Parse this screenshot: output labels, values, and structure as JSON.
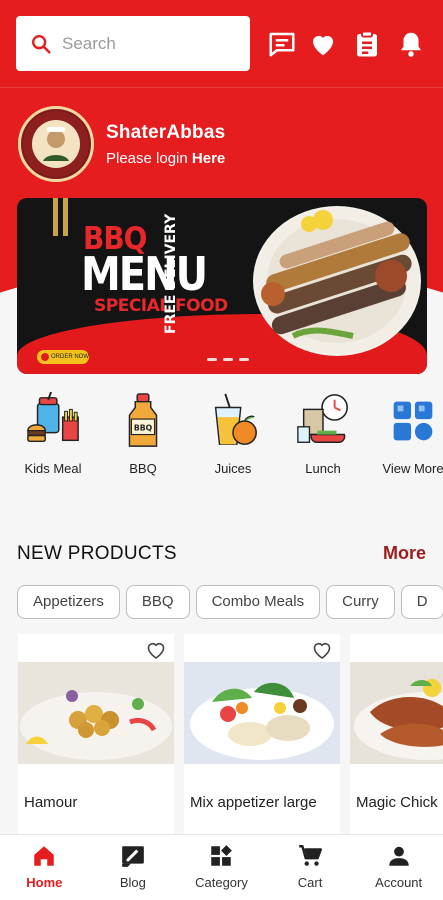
{
  "search": {
    "placeholder": "Search"
  },
  "top_icons": [
    "chat-icon",
    "heart-icon",
    "clipboard-icon",
    "bell-icon"
  ],
  "brand": {
    "name": "ShaterAbbas",
    "login_prefix": "Please login ",
    "login_link": "Here"
  },
  "banner": {
    "line1": "BBQ",
    "line2": "MENU",
    "line3": "SPECIAL FOOD",
    "side": "FREE DELIVERY",
    "order_pill": "ORDER NOW",
    "slide_count": 3
  },
  "categories": [
    {
      "label": "Kids Meal",
      "icon": "kids-meal-icon"
    },
    {
      "label": "BBQ",
      "icon": "bbq-sauce-icon"
    },
    {
      "label": "Juices",
      "icon": "juice-icon"
    },
    {
      "label": "Lunch",
      "icon": "lunch-icon"
    },
    {
      "label": "View More",
      "icon": "grid-icon"
    }
  ],
  "new_products": {
    "title": "NEW PRODUCTS",
    "more_label": "More",
    "chips": [
      "Appetizers",
      "BBQ",
      "Combo Meals",
      "Curry",
      "D"
    ],
    "items": [
      {
        "name": "Hamour"
      },
      {
        "name": "Mix appetizer large"
      },
      {
        "name": "Magic Chick"
      }
    ]
  },
  "bottom_nav": [
    {
      "label": "Home",
      "icon": "home-icon",
      "active": true
    },
    {
      "label": "Blog",
      "icon": "blog-icon",
      "active": false
    },
    {
      "label": "Category",
      "icon": "category-icon",
      "active": false
    },
    {
      "label": "Cart",
      "icon": "cart-icon",
      "active": false
    },
    {
      "label": "Account",
      "icon": "account-icon",
      "active": false
    }
  ],
  "colors": {
    "brand_red": "#e51d1f",
    "more_red": "#9c1c1c",
    "background": "#f6f6f6"
  }
}
